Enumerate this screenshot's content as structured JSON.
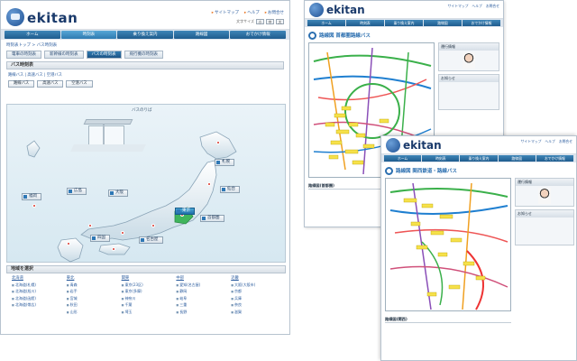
{
  "left": {
    "topline": "",
    "brand": "ekitan",
    "util_links": [
      "サイトマップ",
      "ヘルプ",
      "お問合せ"
    ],
    "font_size_label": "文字サイズ",
    "font_sizes": [
      "小",
      "中",
      "大"
    ],
    "nav": [
      "ホーム",
      "時刻表",
      "乗り換え案内",
      "路線図",
      "おでかけ情報"
    ],
    "nav_active": 1,
    "breadcrumb": "時刻表トップ > バス時刻表",
    "subtabs": [
      "電車の時刻表",
      "新幹線の時刻表",
      "バスの時刻表",
      "飛行機の時刻表"
    ],
    "subtab_active": 2,
    "panel_title": "バス時刻表",
    "links_row": "路線バス | 高速バス | 空港バス",
    "buttons": [
      "路線バス",
      "高速バス",
      "空港バス"
    ],
    "map": {
      "title": "バスのりば",
      "cities": [
        {
          "name": "札幌",
          "cls": ""
        },
        {
          "name": "仙台",
          "cls": ""
        },
        {
          "name": "首都圏",
          "cls": ""
        },
        {
          "name": "東京",
          "cls": "tokyo"
        },
        {
          "name": "名古屋",
          "cls": ""
        },
        {
          "name": "大阪",
          "cls": ""
        },
        {
          "name": "広島",
          "cls": ""
        },
        {
          "name": "福岡",
          "cls": ""
        },
        {
          "name": "四国",
          "cls": ""
        }
      ]
    },
    "regions_title": "地域を選択",
    "regions": [
      {
        "head": "北海道",
        "items": [
          "北海道(札幌)",
          "北海道(旭川)",
          "北海道(函館)",
          "北海道(帯広)"
        ]
      },
      {
        "head": "東北",
        "items": [
          "青森",
          "岩手",
          "宮城",
          "秋田",
          "山形"
        ]
      },
      {
        "head": "関東",
        "items": [
          "東京(23区)",
          "東京(多摩)",
          "神奈川",
          "千葉",
          "埼玉"
        ]
      },
      {
        "head": "中部",
        "items": [
          "愛知(名古屋)",
          "静岡",
          "岐阜",
          "三重",
          "長野"
        ]
      },
      {
        "head": "近畿",
        "items": [
          "大阪(大阪市)",
          "京都",
          "兵庫",
          "奈良",
          "滋賀"
        ]
      }
    ]
  },
  "right1": {
    "brand": "ekitan",
    "util_links": [
      "サイトマップ",
      "ヘルプ",
      "お問合せ"
    ],
    "nav": [
      "ホーム",
      "時刻表",
      "乗り換え案内",
      "路線図",
      "おでかけ情報"
    ],
    "title": "路線図 首都圏路線バス",
    "side_box1": "運行情報",
    "side_box2": "お知らせ",
    "section": "路線図(首都圏)"
  },
  "right2": {
    "brand": "ekitan",
    "util_links": [
      "サイトマップ",
      "ヘルプ",
      "お問合せ"
    ],
    "nav": [
      "ホーム",
      "時刻表",
      "乗り換え案内",
      "路線図",
      "おでかけ情報"
    ],
    "title": "路線図 関西鉄道・路線バス",
    "side_box1": "運行情報",
    "side_box2": "お知らせ",
    "section": "路線図(関西)"
  }
}
